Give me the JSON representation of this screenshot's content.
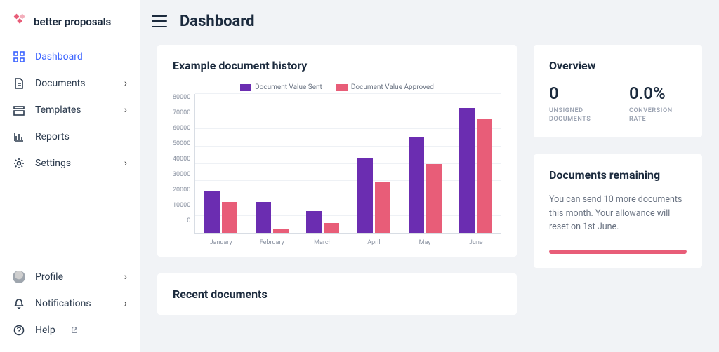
{
  "brand": {
    "name": "better proposals"
  },
  "nav": {
    "main": [
      {
        "label": "Dashboard",
        "icon": "grid-icon",
        "has_children": false
      },
      {
        "label": "Documents",
        "icon": "document-icon",
        "has_children": true
      },
      {
        "label": "Templates",
        "icon": "templates-icon",
        "has_children": true
      },
      {
        "label": "Reports",
        "icon": "reports-icon",
        "has_children": false
      },
      {
        "label": "Settings",
        "icon": "gear-icon",
        "has_children": true
      }
    ],
    "footer": [
      {
        "label": "Profile",
        "icon": "avatar-icon",
        "has_children": true
      },
      {
        "label": "Notifications",
        "icon": "bell-icon",
        "has_children": true
      },
      {
        "label": "Help",
        "icon": "help-icon",
        "has_children": false,
        "external": true
      }
    ],
    "active": "Dashboard"
  },
  "page": {
    "title": "Dashboard"
  },
  "history_card": {
    "title": "Example document history"
  },
  "recent_card": {
    "title": "Recent documents"
  },
  "overview": {
    "title": "Overview",
    "stats": [
      {
        "value": "0",
        "label": "UNSIGNED DOCUMENTS"
      },
      {
        "value": "0.0%",
        "label": "CONVERSION RATE"
      }
    ]
  },
  "remaining": {
    "title": "Documents remaining",
    "text": "You can send 10 more documents this month. Your allowance will reset on 1st June.",
    "progress_pct": 100
  },
  "chart_data": {
    "type": "bar",
    "title": "Example document history",
    "xlabel": "",
    "ylabel": "",
    "ylim": [
      0,
      80000
    ],
    "yticks": [
      0,
      10000,
      20000,
      30000,
      40000,
      50000,
      60000,
      70000,
      80000
    ],
    "categories": [
      "January",
      "February",
      "March",
      "April",
      "May",
      "June"
    ],
    "series": [
      {
        "name": "Document Value Sent",
        "color": "#6b2db1",
        "values": [
          24000,
          18000,
          13000,
          43000,
          55000,
          72000
        ]
      },
      {
        "name": "Document Value Approved",
        "color": "#e85d78",
        "values": [
          18000,
          3000,
          6000,
          29500,
          40000,
          66000
        ]
      }
    ],
    "legend_position": "top"
  }
}
